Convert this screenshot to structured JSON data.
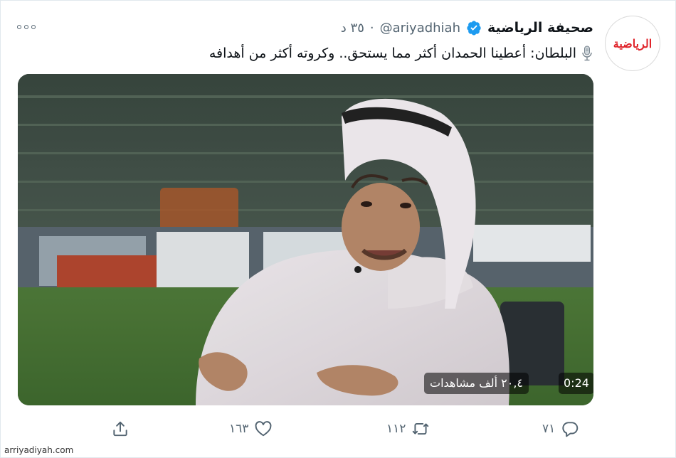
{
  "tweet": {
    "display_name": "صحيفة الرياضية",
    "handle": "@ariyadhiah",
    "separator": "·",
    "time_ago": "٣٥ د",
    "text": "البلطان: أعطينا الحمدان أكثر مما يستحق.. وكروته أكثر من أهدافه",
    "avatar_logo_text": "الرياضية",
    "verified": true
  },
  "video": {
    "duration": "0:24",
    "views": "٢٠,٤ ألف مشاهدات"
  },
  "actions": {
    "reply_count": "٧١",
    "retweet_count": "١١٢",
    "like_count": "١٦٣"
  },
  "watermark": "arriyadiyah.com",
  "colors": {
    "accent": "#1d9bf0",
    "secondary_text": "#536471",
    "brand_red": "#e0242b"
  },
  "icons": {
    "more": "more-icon",
    "verified": "verified-badge-icon",
    "mic": "microphone-icon",
    "reply": "reply-icon",
    "retweet": "retweet-icon",
    "like": "heart-icon",
    "share": "share-icon"
  }
}
